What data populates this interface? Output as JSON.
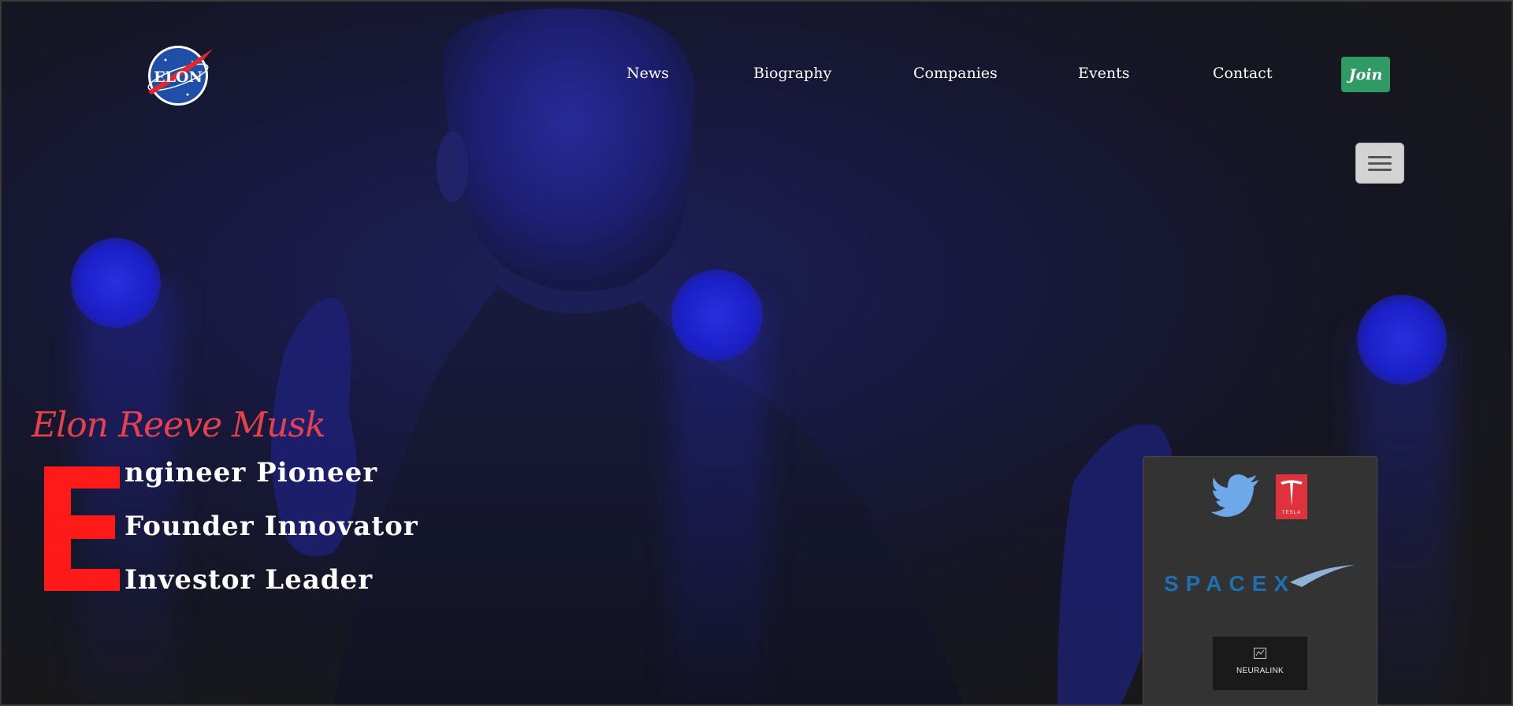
{
  "header": {
    "logo_text": "ELON",
    "nav": [
      {
        "label": "News"
      },
      {
        "label": "Biography"
      },
      {
        "label": "Companies"
      },
      {
        "label": "Events"
      },
      {
        "label": "Contact"
      }
    ],
    "join_label": "Join"
  },
  "hero": {
    "name": "Elon Reeve Musk",
    "big_letter": "E",
    "roles": [
      "ngineer Pioneer",
      "Founder Innovator",
      "Investor Leader"
    ]
  },
  "companies": {
    "twitter_icon": "twitter-bird-icon",
    "tesla_text": "TESLA",
    "spacex_text": "SPACEX",
    "neuralink_text": "NEURALINK"
  },
  "colors": {
    "accent_red": "#e5414a",
    "big_e_red": "#ff1a1a",
    "join_green": "#2f9a63",
    "twitter_blue": "#6fa8e8",
    "tesla_red": "#e0323c",
    "spacex_blue": "#1f6fb5"
  }
}
